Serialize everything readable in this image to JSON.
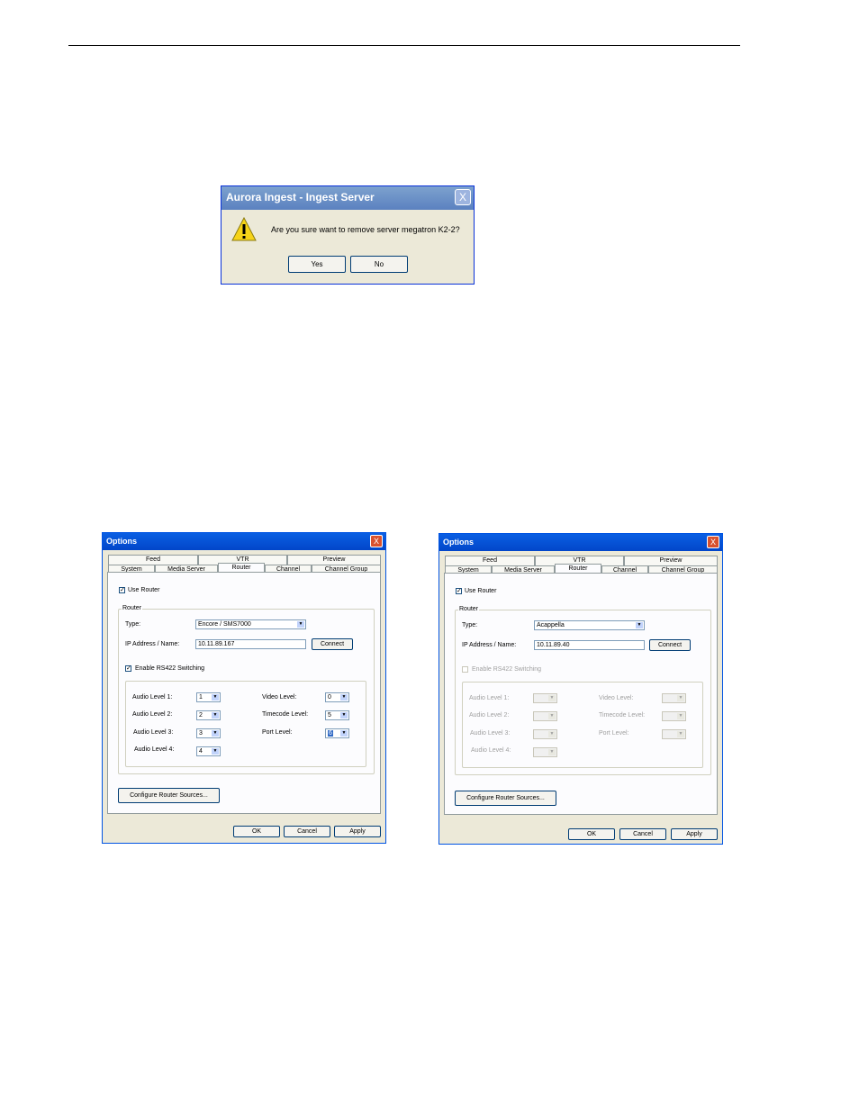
{
  "confirm_dialog": {
    "title": "Aurora Ingest - Ingest Server",
    "message": "Are you sure want to remove server megatron K2-2?",
    "yes_label": "Yes",
    "no_label": "No",
    "close_label": "X"
  },
  "options_left": {
    "title": "Options",
    "close_label": "X",
    "tabs_back": [
      "Feed",
      "VTR",
      "Preview"
    ],
    "tabs_front": [
      "System",
      "Media Server",
      "Router",
      "Channel",
      "Channel Group"
    ],
    "selected_tab": "Router",
    "use_router_label": "Use Router",
    "use_router_checked": "✓",
    "router_group_label": "Router",
    "type_label": "Type:",
    "type_value": "Encore / SMS7000",
    "ip_label": "IP Address / Name:",
    "ip_value": "10.11.89.167",
    "connect_label": "Connect",
    "rs422_label": "Enable RS422 Switching",
    "rs422_checked": "✓",
    "levels": {
      "audio1_label": "Audio Level 1:",
      "audio1_value": "1",
      "audio2_label": "Audio Level 2:",
      "audio2_value": "2",
      "audio3_label": "Audio Level 3:",
      "audio3_value": "3",
      "audio4_label": "Audio Level 4:",
      "audio4_value": "4",
      "video_label": "Video Level:",
      "video_value": "0",
      "timecode_label": "Timecode Level:",
      "timecode_value": "5",
      "port_label": "Port Level:",
      "port_value": "6"
    },
    "configure_label": "Configure Router Sources...",
    "ok_label": "OK",
    "cancel_label": "Cancel",
    "apply_label": "Apply"
  },
  "options_right": {
    "title": "Options",
    "close_label": "X",
    "tabs_back": [
      "Feed",
      "VTR",
      "Preview"
    ],
    "tabs_front": [
      "System",
      "Media Server",
      "Router",
      "Channel",
      "Channel Group"
    ],
    "selected_tab": "Router",
    "use_router_label": "Use Router",
    "use_router_checked": "✓",
    "router_group_label": "Router",
    "type_label": "Type:",
    "type_value": "Acappella",
    "ip_label": "IP Address / Name:",
    "ip_value": "10.11.89.40",
    "connect_label": "Connect",
    "rs422_label": "Enable RS422 Switching",
    "levels": {
      "audio1_label": "Audio Level 1:",
      "audio2_label": "Audio Level 2:",
      "audio3_label": "Audio Level 3:",
      "audio4_label": "Audio Level 4:",
      "video_label": "Video Level:",
      "timecode_label": "Timecode Level:",
      "port_label": "Port Level:"
    },
    "configure_label": "Configure Router Sources...",
    "ok_label": "OK",
    "cancel_label": "Cancel",
    "apply_label": "Apply"
  },
  "colors": {
    "dialog_face": "#ece9d8",
    "xp_blue": "#0a5fe3",
    "warning_yellow": "#f6d319"
  }
}
